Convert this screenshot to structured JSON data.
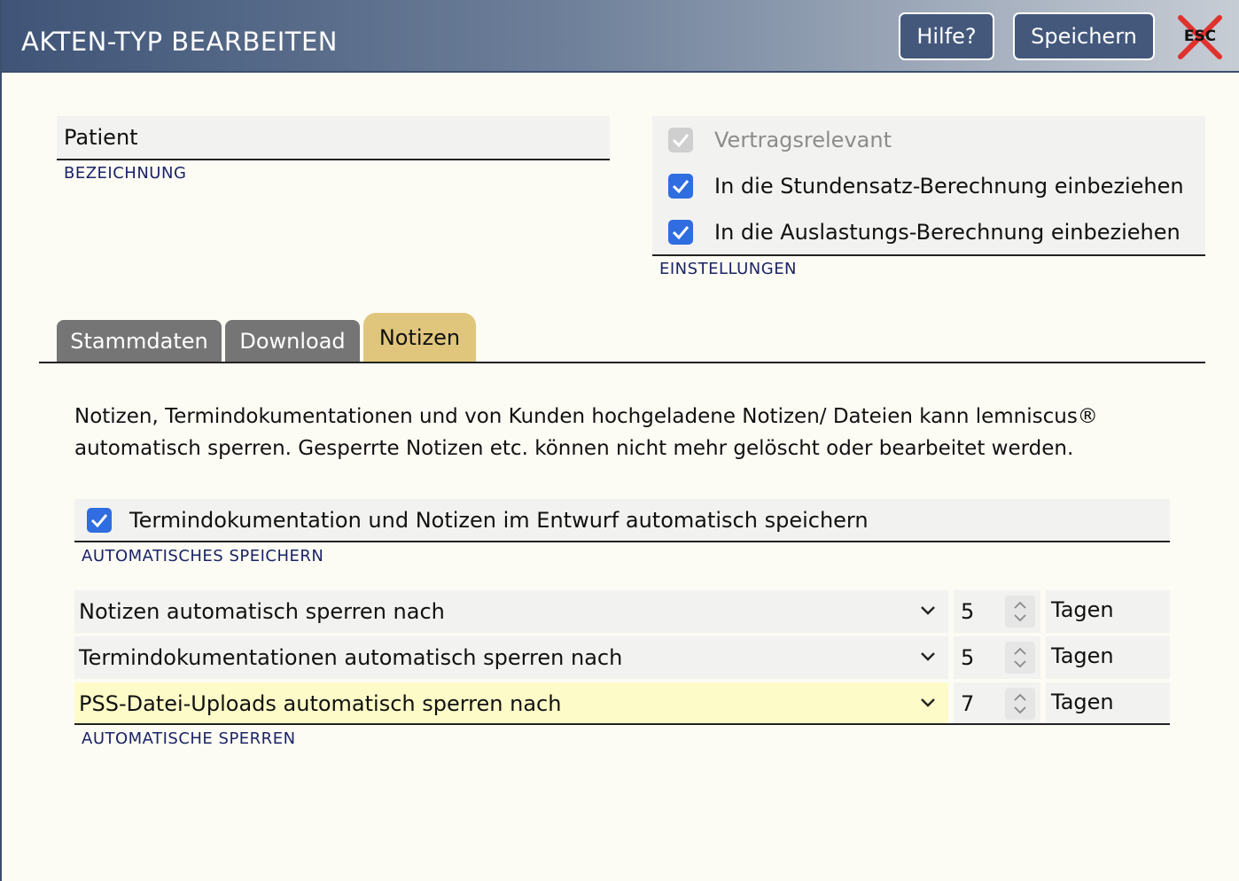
{
  "header": {
    "title": "AKTEN-TYP BEARBEITEN",
    "help_label": "Hilfe?",
    "save_label": "Speichern",
    "esc_label": "ESC"
  },
  "bezeichnung": {
    "value": "Patient",
    "caption": "BEZEICHNUNG"
  },
  "einstellungen": {
    "caption": "EINSTELLUNGEN",
    "items": [
      {
        "label": "Vertragsrelevant",
        "checked": true,
        "disabled": true
      },
      {
        "label": "In die Stundensatz-Berechnung einbeziehen",
        "checked": true,
        "disabled": false
      },
      {
        "label": "In die Auslastungs-Berechnung einbeziehen",
        "checked": true,
        "disabled": false
      }
    ]
  },
  "tabs": [
    {
      "label": "Stammdaten",
      "active": false
    },
    {
      "label": "Download",
      "active": false
    },
    {
      "label": "Notizen",
      "active": true
    }
  ],
  "notizen": {
    "description": "Notizen, Termindokumentationen und von Kunden hochgeladene Notizen/ Dateien kann lemniscus® automatisch sperren. Gesperrte Notizen etc. können nicht mehr gelöscht oder bearbeitet werden.",
    "auto_save": {
      "label": "Termindokumentation und Notizen im Entwurf automatisch speichern",
      "checked": true,
      "caption": "AUTOMATISCHES SPEICHERN"
    },
    "locks": {
      "caption": "AUTOMATISCHE SPERREN",
      "rows": [
        {
          "label": "Notizen automatisch sperren nach",
          "value": "5",
          "unit": "Tagen",
          "highlighted": false
        },
        {
          "label": "Termindokumentationen automatisch sperren nach",
          "value": "5",
          "unit": "Tagen",
          "highlighted": false
        },
        {
          "label": "PSS-Datei-Uploads automatisch sperren nach",
          "value": "7",
          "unit": "Tagen",
          "highlighted": true
        }
      ]
    }
  },
  "colors": {
    "checkbox": "#2f6de0",
    "active_tab": "#e0c67c",
    "inactive_tab": "#757575",
    "header_button": "#44587c",
    "highlight_row": "#fdfcc8",
    "caption": "#1a2466"
  }
}
